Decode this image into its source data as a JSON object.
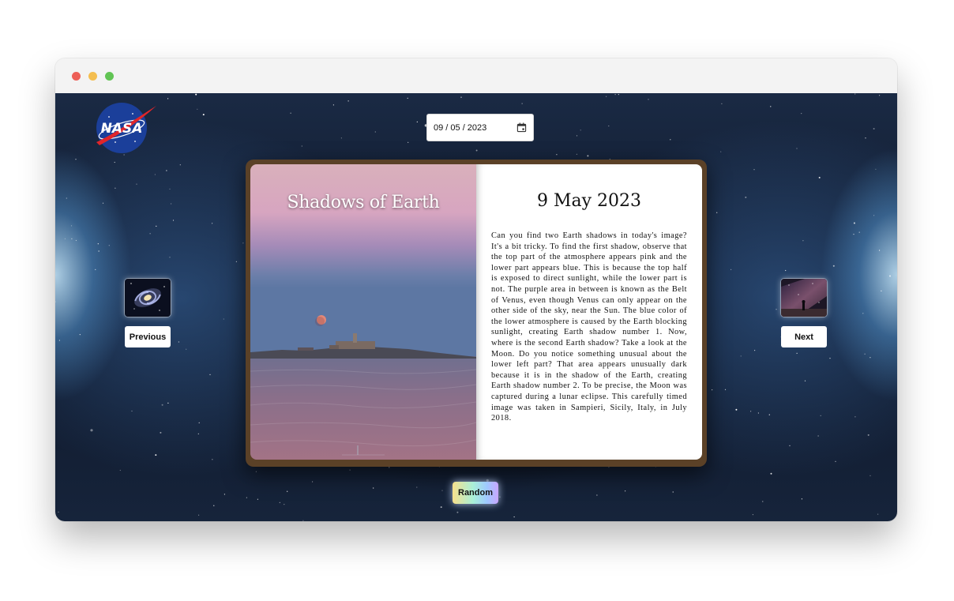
{
  "window": {
    "controls": [
      "close",
      "minimize",
      "maximize"
    ]
  },
  "logo": {
    "text": "NASA",
    "icon": "nasa-meatball-logo"
  },
  "date_picker": {
    "value": "09 / 05 / 2023",
    "icon": "calendar-icon"
  },
  "book": {
    "title": "Shadows of Earth",
    "date": "9 May 2023",
    "explanation": "Can you find two Earth shadows in today's image? It's a bit tricky. To find the first shadow, observe that the top part of the atmosphere appears pink and the lower part appears blue. This is because the top half is exposed to direct sunlight, while the lower part is not. The purple area in between is known as the Belt of Venus, even though Venus can only appear on the other side of the sky, near the Sun. The blue color of the lower atmosphere is caused by the Earth blocking sunlight, creating Earth shadow number 1. Now, where is the second Earth shadow? Take a look at the Moon. Do you notice something unusual about the lower left part? That area appears unusually dark because it is in the shadow of the Earth, creating Earth shadow number 2. To be precise, the Moon was captured during a lunar eclipse. This carefully timed image was taken in Sampieri, Sicily, Italy, in July 2018."
  },
  "navigation": {
    "previous_label": "Previous",
    "next_label": "Next",
    "random_label": "Random"
  },
  "colors": {
    "book_frame": "#5b4127",
    "sky_pink": "#d8a8b8",
    "sky_blue": "#5e78a4",
    "moon": "#e88a78"
  }
}
